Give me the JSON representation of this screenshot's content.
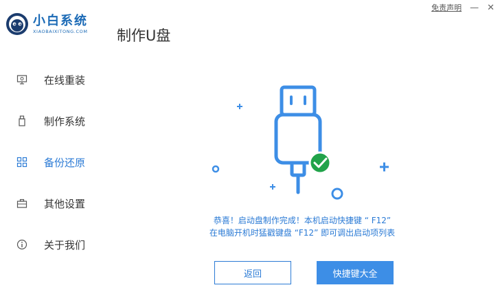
{
  "titlebar": {
    "disclaimer": "免责声明",
    "minimize": "—",
    "close": "✕"
  },
  "logo": {
    "name": "小白系统",
    "subtitle": "XIAOBAIXITONG.COM"
  },
  "page_title": "制作U盘",
  "sidebar": {
    "items": [
      {
        "label": "在线重装",
        "icon": "monitor-icon"
      },
      {
        "label": "制作系统",
        "icon": "usb-icon"
      },
      {
        "label": "备份还原",
        "icon": "grid-icon",
        "active": true
      },
      {
        "label": "其他设置",
        "icon": "briefcase-icon"
      },
      {
        "label": "关于我们",
        "icon": "info-icon"
      }
    ]
  },
  "message": {
    "line1": "恭喜！启动盘制作完成！本机启动快捷键 “ F12”",
    "line2": "在电脑开机时猛戳键盘 “F12” 即可调出启动项列表"
  },
  "buttons": {
    "back": "返回",
    "shortcut_keys": "快捷键大全"
  },
  "colors": {
    "accent": "#2a7ad5",
    "brand": "#1b6ab6",
    "success": "#21a34a"
  }
}
